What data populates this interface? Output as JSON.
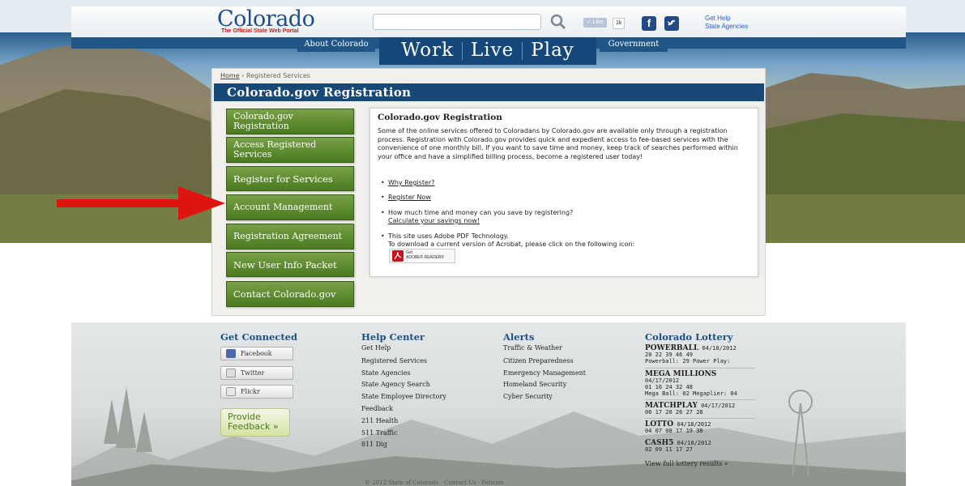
{
  "header": {
    "logo_title": "Colorado",
    "logo_subtitle": "The Official State Web Portal",
    "search_placeholder": "",
    "like_label": "✓ Like",
    "like_count": "1k",
    "get_help": "Get Help",
    "state_agencies": "State Agencies"
  },
  "nav": {
    "about": "About Colorado",
    "work": "Work",
    "live": "Live",
    "play": "Play",
    "government": "Government"
  },
  "breadcrumb": {
    "home": "Home",
    "sep": "›",
    "current": "Registered Services"
  },
  "page_title": "Colorado.gov Registration",
  "sidebar": [
    {
      "label": "Colorado.gov Registration"
    },
    {
      "label": "Access Registered Services"
    },
    {
      "label": "Register for Services"
    },
    {
      "label": "Account Management"
    },
    {
      "label": "Registration Agreement"
    },
    {
      "label": "New User Info Packet"
    },
    {
      "label": "Contact Colorado.gov"
    }
  ],
  "panel": {
    "title": "Colorado.gov Registration",
    "intro": "Some of the online services offered to Coloradans by Colorado.gov are available only through a registration process. Registration with Colorado.gov provides quick and expedient access to fee-based services with the convenience of one monthly bill. If you want to save time and money, keep track of searches performed within your office and have a simplified billing process, become a registered user today!",
    "why_register": "Why Register?",
    "register_now": "Register Now",
    "save_question": "How much time and money can you save by registering?",
    "calculate": "Calculate your savings now!",
    "pdf_line1": "This site uses Adobe PDF Technology.",
    "pdf_line2": "To download a current version of Acrobat, please click on the following icon:",
    "adobe_get": "Get",
    "adobe_reader": "ADOBE® READER®"
  },
  "footer": {
    "get_connected": {
      "title": "Get Connected",
      "facebook": "Facebook",
      "twitter": "Twitter",
      "flickr": "Flickr",
      "feedback": "Provide Feedback »"
    },
    "help_center": {
      "title": "Help Center",
      "links": [
        "Get Help",
        "Registered Services",
        "State Agencies",
        "State Agency Search",
        "State Employee Directory",
        "Feedback",
        "211 Health",
        "511 Traffic",
        "811 Dig"
      ]
    },
    "alerts": {
      "title": "Alerts",
      "links": [
        "Traffic & Weather",
        "Citizen Preparedness",
        "Emergency Management",
        "Homeland Security",
        "Cyber Security"
      ]
    },
    "lottery": {
      "title": "Colorado Lottery",
      "powerball_name": "POWERBALL",
      "powerball_date": "04/18/2012",
      "powerball_numbers": "20  22  39  46  49",
      "powerball_extra": "Powerball: 29 Power Play:",
      "mega_name": "MEGA MILLIONS",
      "mega_date": "04/17/2012",
      "mega_numbers": "01  16  24  32  48",
      "mega_extra": "Mega Ball: 02 Megaplier: 04",
      "match_name": "MATCHPLAY",
      "match_date": "04/17/2012",
      "match_numbers": "06  17  20  26  27  28",
      "lotto_name": "LOTTO",
      "lotto_date": "04/18/2012",
      "lotto_numbers": "04  07  08  17  19  38",
      "cash_name": "CASH5",
      "cash_date": "04/18/2012",
      "cash_numbers": "02  09  11  17  27",
      "view_all": "View full lottery results »"
    },
    "bottom": "© 2012 State of Colorado  ·  Contact Us  ·  Policies"
  }
}
